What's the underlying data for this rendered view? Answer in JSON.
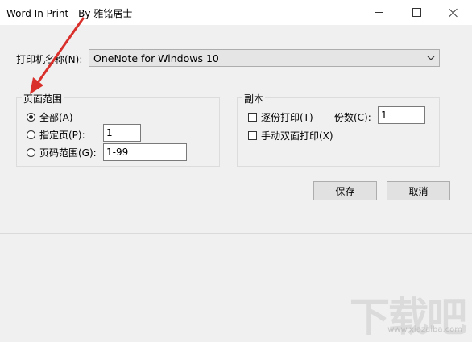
{
  "window": {
    "title": "Word In Print - By 雅铭居士"
  },
  "printer": {
    "label": "打印机名称(N):",
    "selected": "OneNote for Windows 10"
  },
  "page_range": {
    "legend": "页面范围",
    "options": [
      {
        "label": "全部(A)",
        "checked": true
      },
      {
        "label": "指定页(P):",
        "checked": false,
        "value": "1"
      },
      {
        "label": "页码范围(G):",
        "checked": false,
        "value": "1-99"
      }
    ]
  },
  "copies": {
    "legend": "副本",
    "collate_label": "逐份打印(T)",
    "count_label": "份数(C):",
    "count_value": "1",
    "duplex_label": "手动双面打印(X)"
  },
  "buttons": {
    "save": "保存",
    "cancel": "取消"
  },
  "watermark": {
    "text": "下载吧",
    "url": "www.xiazaiba.com"
  },
  "colors": {
    "annotation_arrow": "#d9302c"
  }
}
